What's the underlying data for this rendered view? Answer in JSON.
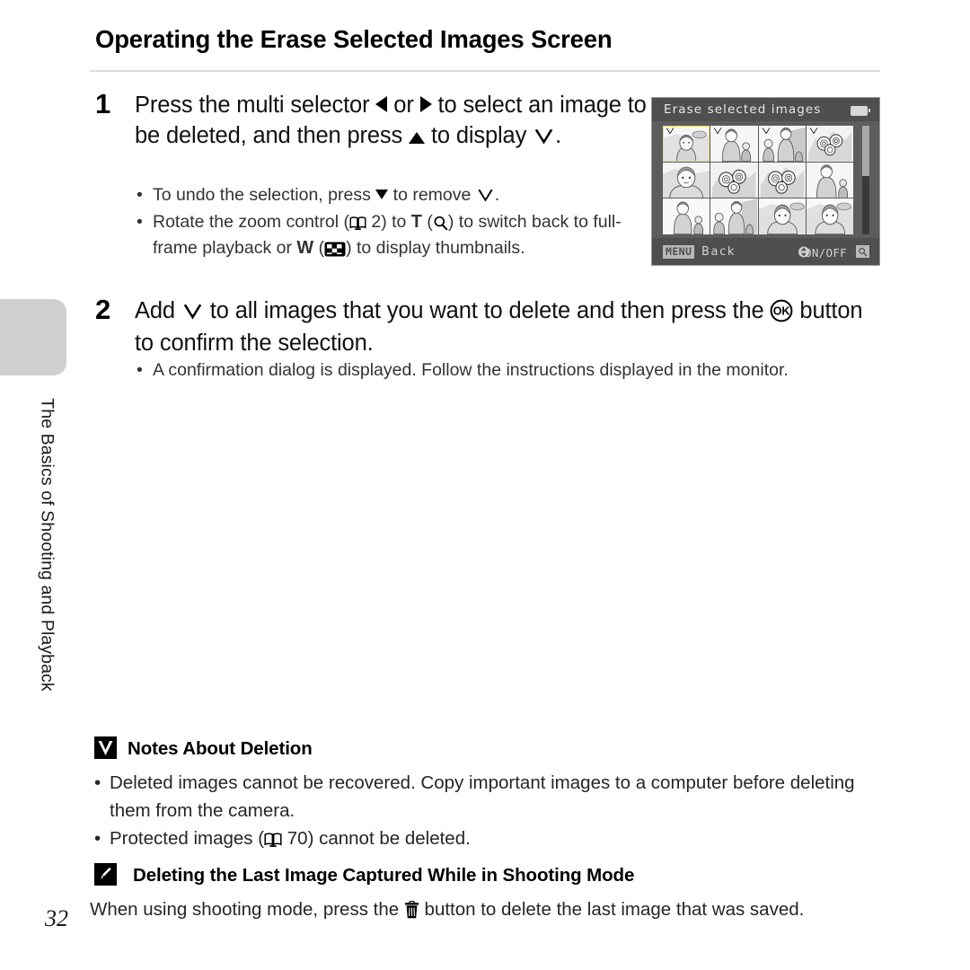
{
  "page": {
    "number": "32",
    "chapter_label": "The Basics of Shooting and Playback",
    "title": "Operating the Erase Selected Images Screen"
  },
  "steps": [
    {
      "number": "1",
      "text_before_left": "Press the multi selector ",
      "text_or": " or ",
      "text_after_right": " to select an image to be deleted, and then press ",
      "text_after_up": " to display ",
      "text_end": ".",
      "icons": [
        "multi-selector-left",
        "multi-selector-right",
        "multi-selector-up",
        "checkmark"
      ],
      "bullets": [
        {
          "parts": [
            "To undo the selection, press ",
            " to remove ",
            "."
          ],
          "icons": [
            "multi-selector-down",
            "checkmark"
          ]
        },
        {
          "parts": [
            "Rotate the zoom control (",
            " 2) to ",
            " (",
            ") to switch back to full-frame playback or ",
            " (",
            ") to display thumbnails."
          ],
          "page_ref": "2",
          "tele_letter": "T",
          "wide_letter": "W",
          "icons": [
            "book-icon",
            "magnifier-icon",
            "thumbnail-icon"
          ]
        }
      ]
    },
    {
      "number": "2",
      "text_start": "Add ",
      "text_middle": " to all images that you want to delete and then press the ",
      "text_end": " button to confirm the selection.",
      "icons": [
        "checkmark",
        "ok-button"
      ],
      "bullets": [
        {
          "parts": [
            "A confirmation dialog is displayed. Follow the instructions displayed in the monitor."
          ],
          "icons": []
        }
      ]
    }
  ],
  "camera_screen": {
    "title": "Erase selected images",
    "battery_icon": "battery-icon",
    "scrollbar": "vertical-scrollbar",
    "bottom_bar": {
      "menu_badge": "MENU",
      "back_label": "Back",
      "updown_icon": "up-down-arrows-icon",
      "onoff_label": "ON/OFF",
      "magnifier_badge": "magnifier-icon"
    },
    "thumbnails": [
      {
        "index": 1,
        "art": "woman-portrait-outdoor",
        "checked": true,
        "selected": true
      },
      {
        "index": 2,
        "art": "woman-with-child",
        "checked": true,
        "selected": false
      },
      {
        "index": 3,
        "art": "child-and-woman",
        "checked": true,
        "selected": false
      },
      {
        "index": 4,
        "art": "flowers",
        "checked": true,
        "selected": false
      },
      {
        "index": 5,
        "art": "woman-portrait-closeup",
        "checked": false,
        "selected": false
      },
      {
        "index": 6,
        "art": "flowers",
        "checked": false,
        "selected": false
      },
      {
        "index": 7,
        "art": "flowers",
        "checked": false,
        "selected": false
      },
      {
        "index": 8,
        "art": "woman-with-child",
        "checked": false,
        "selected": false
      },
      {
        "index": 9,
        "art": "woman-with-child",
        "checked": false,
        "selected": false
      },
      {
        "index": 10,
        "art": "child-and-woman",
        "checked": false,
        "selected": false
      },
      {
        "index": 11,
        "art": "woman-portrait-outdoor",
        "checked": false,
        "selected": false
      },
      {
        "index": 12,
        "art": "woman-portrait-outdoor",
        "checked": false,
        "selected": false
      }
    ]
  },
  "notes": {
    "badge_icon": "checkmark-badge-icon",
    "heading": "Notes About Deletion",
    "items": [
      "Deleted images cannot be recovered. Copy important images to a computer before deleting them from the camera.",
      "Protected images ( 70) cannot be deleted."
    ],
    "protected_prefix": "Protected images (",
    "protected_page_ref": "70",
    "protected_suffix": ") cannot be deleted."
  },
  "tip": {
    "badge_icon": "pencil-badge-icon",
    "heading": "Deleting the Last Image Captured While in Shooting Mode",
    "text_before": "When using shooting mode, press the ",
    "text_after": " button to delete the last image that was saved.",
    "icon": "trash-icon"
  },
  "colors": {
    "page_bg": "#ffffff",
    "text": "#1a1a1a",
    "rule": "#dcdcdc",
    "tab_gray": "#d0d0d0",
    "screen_body": "#5d5d5d",
    "screen_bar": "#4f4f4f",
    "screen_text": "#e8e8e8",
    "selection_yellow": "#e8e06a",
    "thumb_bg": "#f4f4f4"
  }
}
